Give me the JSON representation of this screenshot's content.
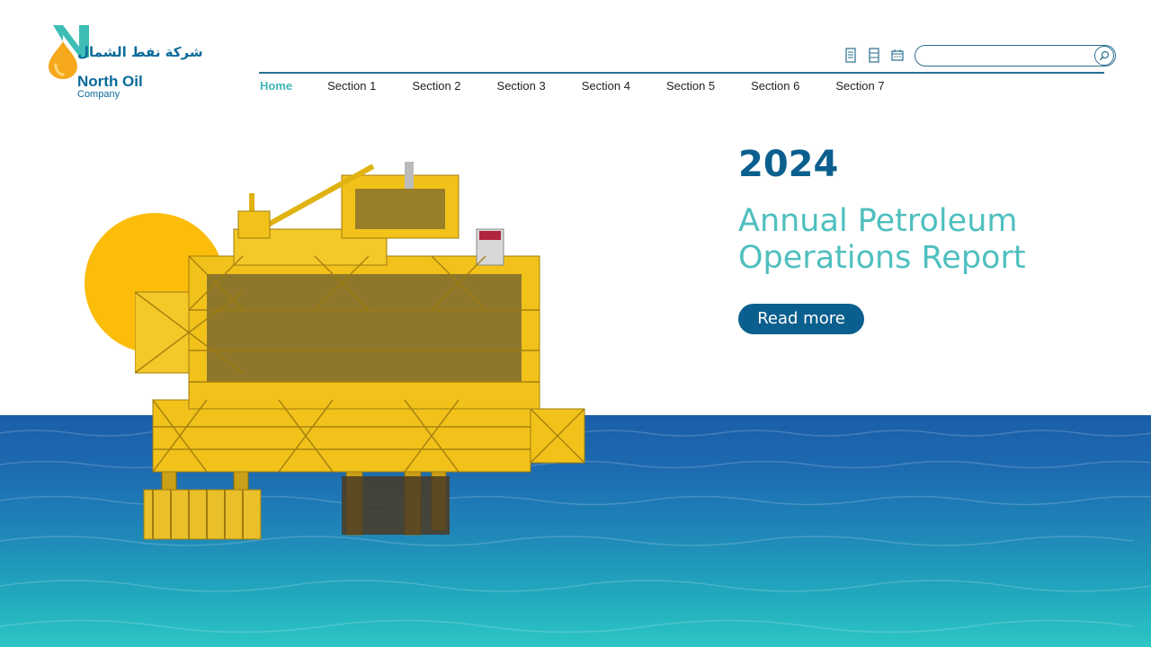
{
  "brand": {
    "arabic_name": "شركة نفط الشمال",
    "name": "North Oil",
    "subname": "Company"
  },
  "toolbar": {
    "icons": [
      "document-icon",
      "document-list-icon",
      "calendar-icon"
    ],
    "search_placeholder": ""
  },
  "nav": {
    "items": [
      {
        "label": "Home",
        "active": true
      },
      {
        "label": "Section 1"
      },
      {
        "label": "Section 2"
      },
      {
        "label": "Section 3"
      },
      {
        "label": "Section 4"
      },
      {
        "label": "Section 5"
      },
      {
        "label": "Section 6"
      },
      {
        "label": "Section 7"
      }
    ]
  },
  "hero": {
    "year": "2024",
    "title_line1": "Annual Petroleum",
    "title_line2": "Operations Report",
    "button_label": "Read more"
  },
  "colors": {
    "primary": "#0b5f8e",
    "accent_teal": "#4fbfbf",
    "sun": "#fbbc0a",
    "rig": "#f2c21b",
    "sea_top": "#1a5ea8",
    "sea_bottom": "#2cc6c4"
  }
}
